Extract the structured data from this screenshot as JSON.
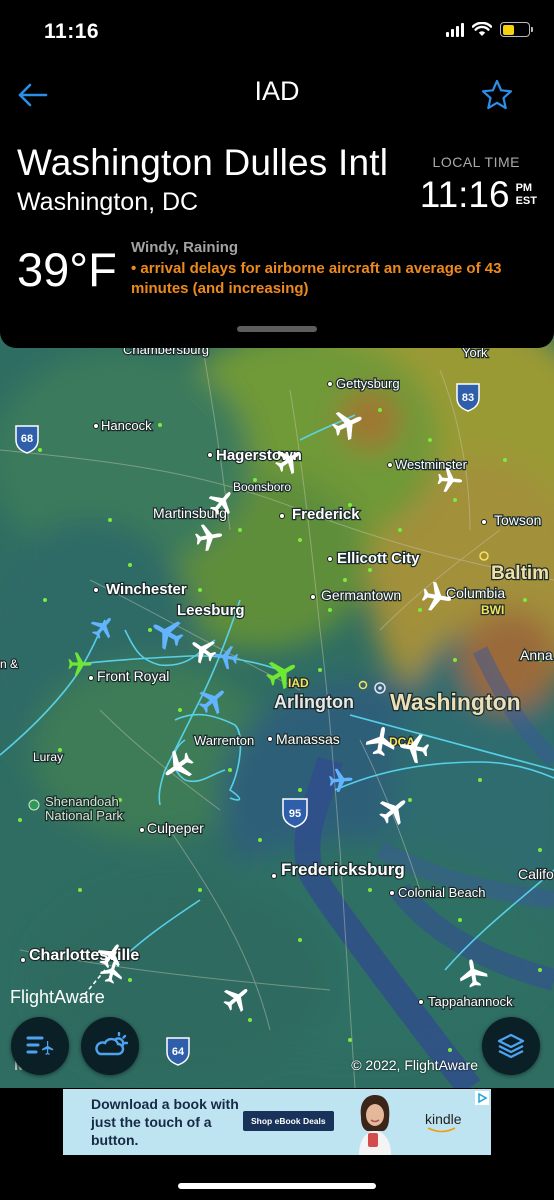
{
  "status_bar": {
    "time": "11:16",
    "battery_level": 0.45
  },
  "header": {
    "title": "IAD",
    "airport_name": "Washington Dulles Intl",
    "city": "Washington, DC",
    "local_time_label": "LOCAL TIME",
    "local_time": "11:16",
    "ampm": "PM",
    "timezone": "EST",
    "temperature": "39°F",
    "conditions": "Windy, Raining",
    "delay_notice": "• arrival delays for airborne aircraft an average of 43 minutes (and increasing)"
  },
  "map": {
    "labels": {
      "chambersburg": "Chambersburg",
      "york": "York",
      "gettysburg": "Gettysburg",
      "hancock": "Hancock",
      "hagerstown": "Hagerstown",
      "westminster": "Westminster",
      "boonsboro": "Boonsboro",
      "martinsburg": "Martinsburg",
      "frederick": "Frederick",
      "towson": "Towson",
      "ellicott_city": "Ellicott City",
      "baltimore": "Baltim",
      "germantown": "Germantown",
      "columbia": "Columbia",
      "bwi": "BWI",
      "winchester": "Winchester",
      "leesburg": "Leesburg",
      "annapolis": "Anna",
      "front_royal": "Front Royal",
      "iad": "IAD",
      "arlington": "Arlington",
      "washington": "Washington",
      "dca": "DCA",
      "warrenton": "Warrenton",
      "manassas": "Manassas",
      "luray": "Luray",
      "shenandoah": "Shenandoah",
      "national_park": "National Park",
      "culpeper": "Culpeper",
      "fredericksburg": "Fredericksburg",
      "colonial_beach": "Colonial Beach",
      "california": "Califo",
      "charlottesville": "Charlottesville",
      "tappahannock": "Tappahannock",
      "left_edge": "n &"
    },
    "shields": {
      "i68": "68",
      "i83": "83",
      "i95": "95",
      "i64": "64"
    },
    "logo": "FlightAware",
    "copyright": "© 2022, FlightAware",
    "maps_credit": "Maps"
  },
  "ad": {
    "text": "Download a book with just the touch of a button.",
    "button": "Shop eBook Deals",
    "brand": "kindle"
  },
  "colors": {
    "accent_blue": "#2c8ee8",
    "delay_orange": "#ee8a1d",
    "arriving_green": "#6fe832",
    "track_cyan": "#58d6ef"
  }
}
